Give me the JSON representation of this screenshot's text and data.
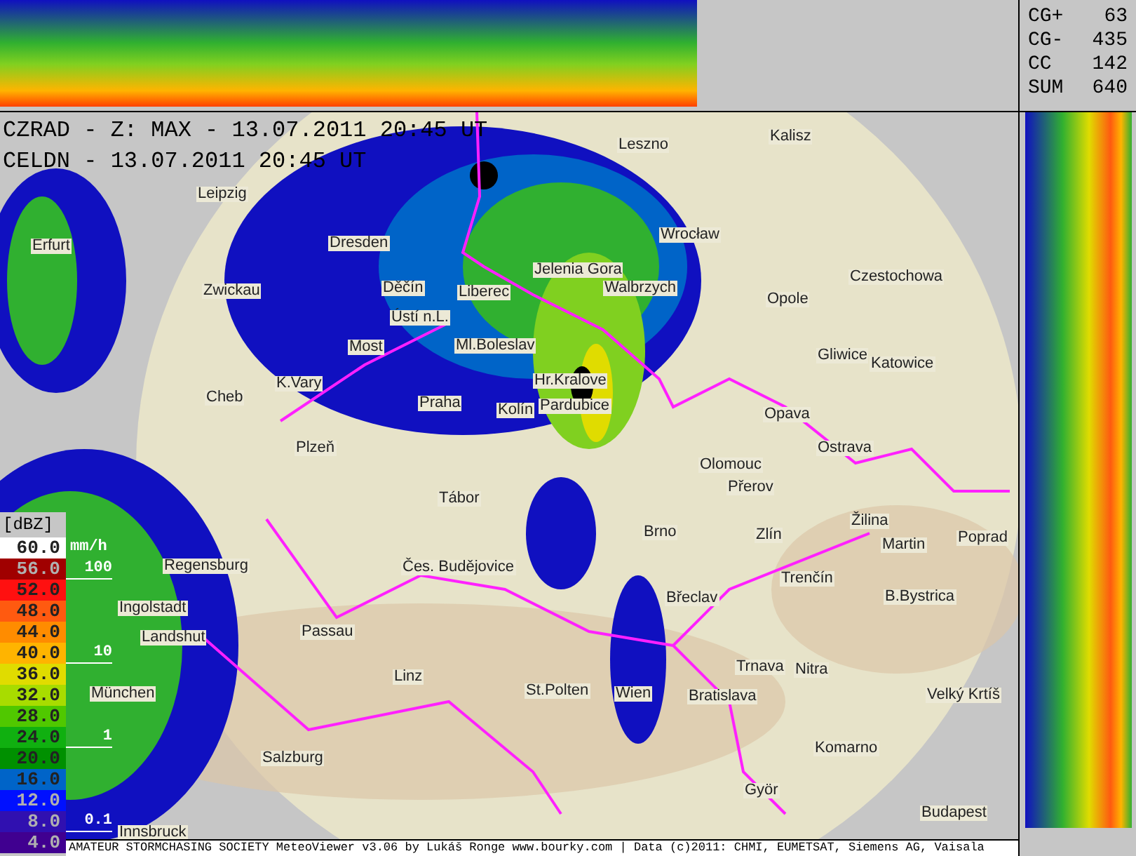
{
  "header": {
    "lines": [
      "CZRAD - Z: MAX - 13.07.2011 20:45 UT",
      "CELDN - 13.07.2011 20:45 UT"
    ]
  },
  "stats": [
    {
      "label": "CG+",
      "value": "63"
    },
    {
      "label": "CG-",
      "value": "435"
    },
    {
      "label": "CC",
      "value": "142"
    },
    {
      "label": "SUM",
      "value": "640"
    }
  ],
  "legend": {
    "unit": "[dBZ]",
    "rain_unit": "mm/h",
    "rain_marks": [
      "100",
      "10",
      "1",
      "0.1"
    ],
    "steps": [
      {
        "label": "60.0",
        "color": "#ffffff"
      },
      {
        "label": "56.0",
        "color": "#a00000"
      },
      {
        "label": "52.0",
        "color": "#ff1010"
      },
      {
        "label": "48.0",
        "color": "#ff5a10"
      },
      {
        "label": "44.0",
        "color": "#ff8c00"
      },
      {
        "label": "40.0",
        "color": "#ffb400"
      },
      {
        "label": "36.0",
        "color": "#e0dc00"
      },
      {
        "label": "32.0",
        "color": "#a8dc00"
      },
      {
        "label": "28.0",
        "color": "#50c800"
      },
      {
        "label": "24.0",
        "color": "#10b010"
      },
      {
        "label": "20.0",
        "color": "#009000"
      },
      {
        "label": "16.0",
        "color": "#0064c8"
      },
      {
        "label": "12.0",
        "color": "#0010ff"
      },
      {
        "label": "8.0",
        "color": "#3010b0"
      },
      {
        "label": "4.0",
        "color": "#400090"
      }
    ]
  },
  "map": {
    "cities": [
      {
        "name": "Kalisz"
      },
      {
        "name": "Leszno"
      },
      {
        "name": "Leipzig"
      },
      {
        "name": "Erfurt"
      },
      {
        "name": "Dresden"
      },
      {
        "name": "Wrocław"
      },
      {
        "name": "Czestochowa"
      },
      {
        "name": "Zwickau"
      },
      {
        "name": "Děčín"
      },
      {
        "name": "Liberec"
      },
      {
        "name": "Jelenia Gora"
      },
      {
        "name": "Walbrzych"
      },
      {
        "name": "Opole"
      },
      {
        "name": "Ústí n.L."
      },
      {
        "name": "Most"
      },
      {
        "name": "Ml.Boleslav"
      },
      {
        "name": "Gliwice"
      },
      {
        "name": "Katowice"
      },
      {
        "name": "K.Vary"
      },
      {
        "name": "Cheb"
      },
      {
        "name": "Hr.Kralove"
      },
      {
        "name": "Praha"
      },
      {
        "name": "Kolín"
      },
      {
        "name": "Pardubice"
      },
      {
        "name": "Opava"
      },
      {
        "name": "Plzeň"
      },
      {
        "name": "Ostrava"
      },
      {
        "name": "Olomouc"
      },
      {
        "name": "Přerov"
      },
      {
        "name": "Tábor"
      },
      {
        "name": "Brno"
      },
      {
        "name": "Zlín"
      },
      {
        "name": "Žilina"
      },
      {
        "name": "Martin"
      },
      {
        "name": "Poprad"
      },
      {
        "name": "Regensburg"
      },
      {
        "name": "Ingolstadt"
      },
      {
        "name": "Čes. Budějovice"
      },
      {
        "name": "Trenčín"
      },
      {
        "name": "Břeclav"
      },
      {
        "name": "B.Bystrica"
      },
      {
        "name": "Passau"
      },
      {
        "name": "Landshut"
      },
      {
        "name": "Trnava"
      },
      {
        "name": "Nitra"
      },
      {
        "name": "Linz"
      },
      {
        "name": "München"
      },
      {
        "name": "St.Polten"
      },
      {
        "name": "Wien"
      },
      {
        "name": "Bratislava"
      },
      {
        "name": "Velký Krtíš"
      },
      {
        "name": "Salzburg"
      },
      {
        "name": "Komarno"
      },
      {
        "name": "Györ"
      },
      {
        "name": "Budapest"
      },
      {
        "name": "Innsbruck"
      }
    ]
  },
  "footer": "AMATEUR STORMCHASING SOCIETY MeteoViewer v3.06 by Lukáš Ronge www.bourky.com | Data (c)2011: CHMI, EUMETSAT, Siemens AG, Vaisala"
}
